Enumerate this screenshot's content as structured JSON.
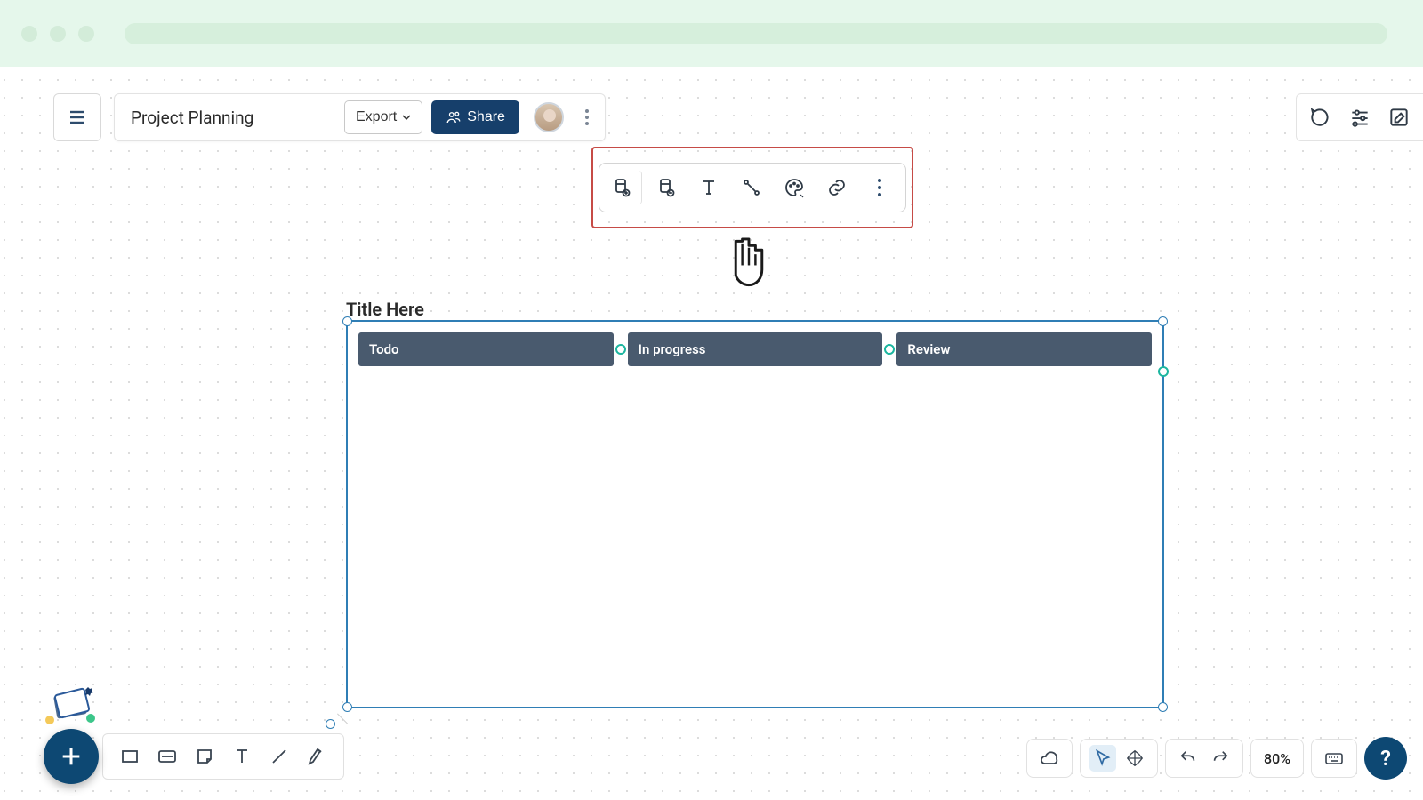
{
  "header": {
    "title": "Project Planning",
    "export_label": "Export",
    "share_label": "Share"
  },
  "context_toolbar": {
    "icons": [
      "add-column-icon",
      "remove-column-icon",
      "text-icon",
      "connector-icon",
      "style-icon",
      "link-icon",
      "more-icon"
    ]
  },
  "top_right_icons": [
    "comment-icon",
    "filter-icon",
    "edit-icon"
  ],
  "kanban": {
    "title": "Title Here",
    "columns": [
      {
        "label": "Todo"
      },
      {
        "label": "In progress"
      },
      {
        "label": "Review"
      }
    ]
  },
  "bottom_left_tools": [
    "rectangle-icon",
    "card-icon",
    "sticky-note-icon",
    "text-tool-icon",
    "line-icon",
    "highlighter-icon"
  ],
  "bottom_right": {
    "zoom": "80%"
  },
  "colors": {
    "primary": "#0d4873",
    "column_bg": "#495a6e",
    "selection": "#2f7eb5",
    "chrome_bg": "#e5f7eb",
    "highlight": "#c64b46",
    "port": "#1cb6a0"
  }
}
